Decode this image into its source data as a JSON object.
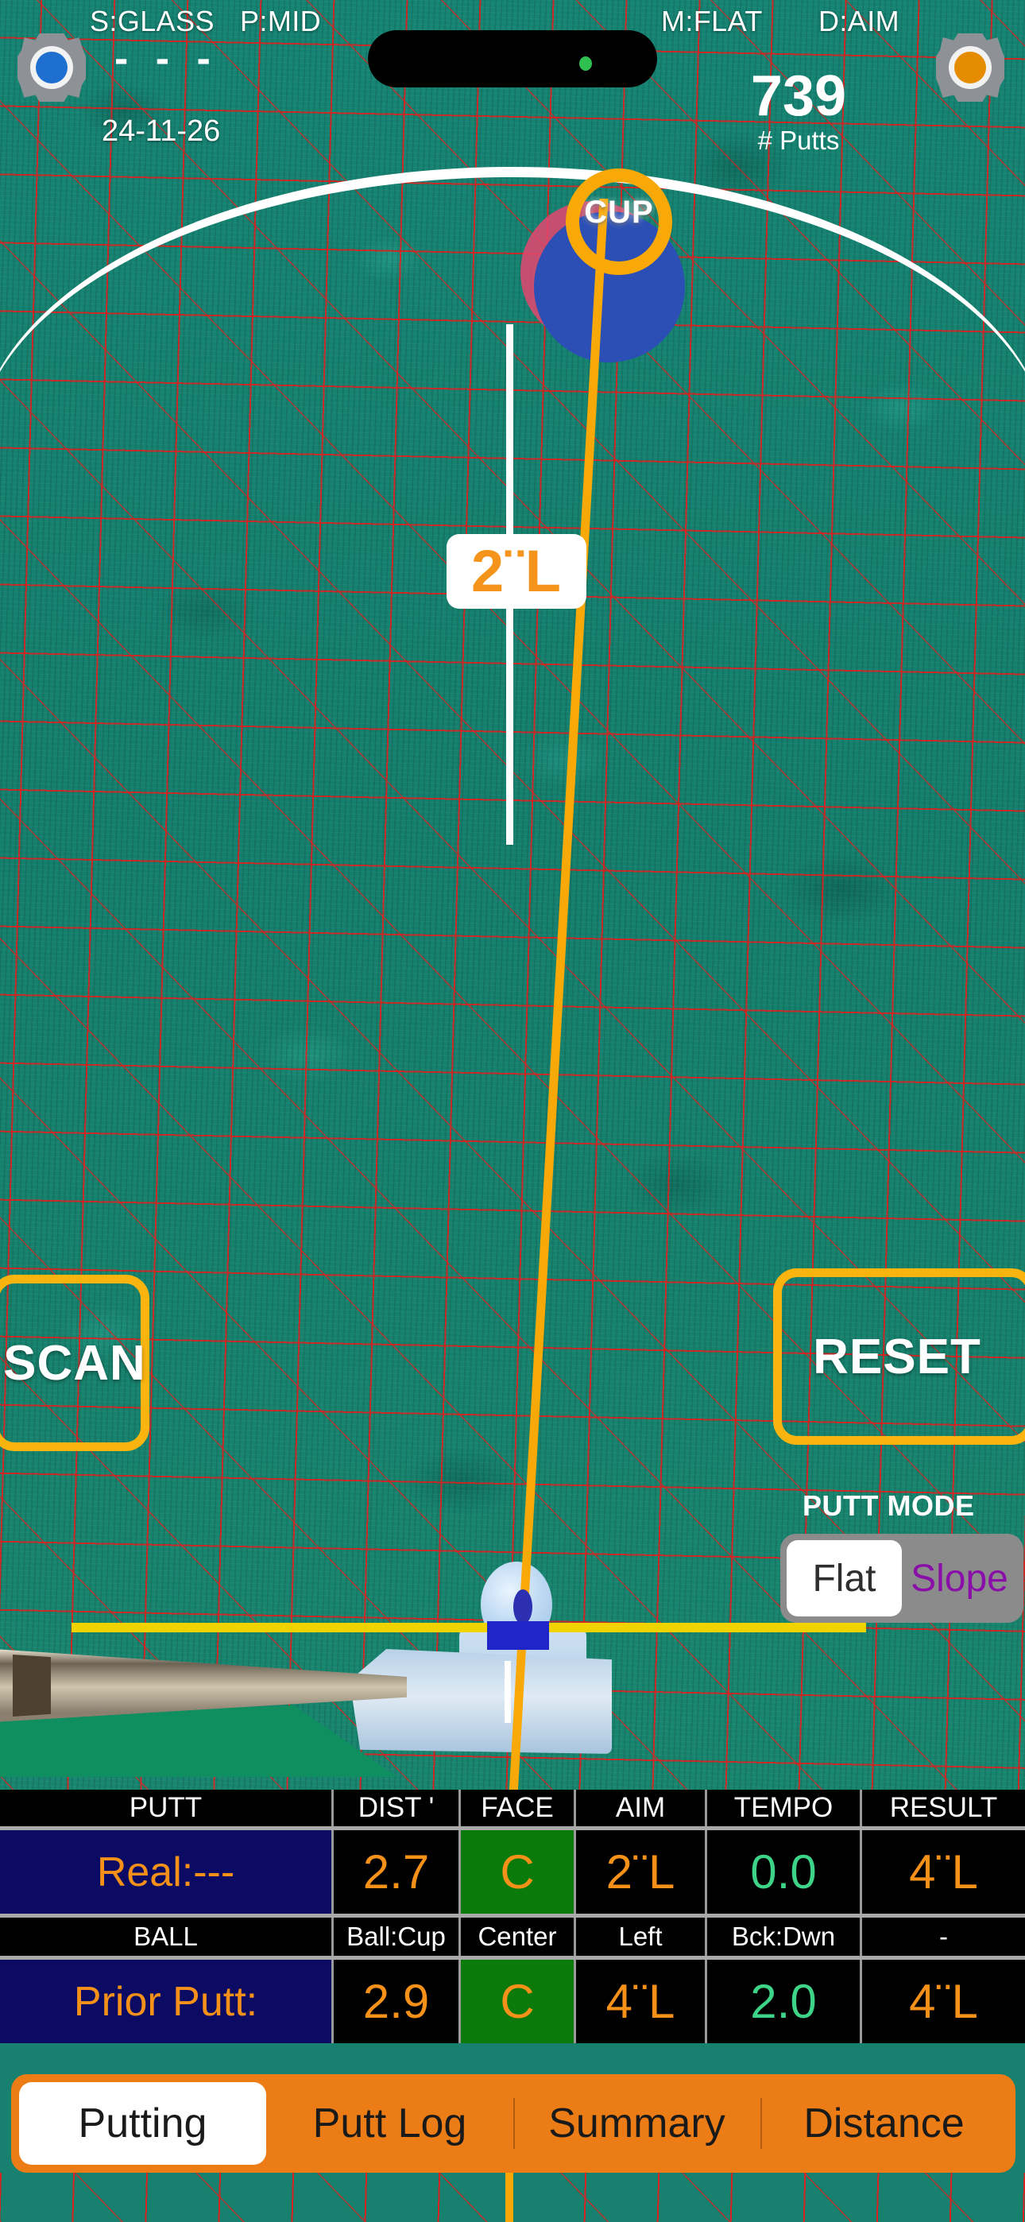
{
  "header": {
    "stimp": "S:GLASS",
    "pace": "P:MID",
    "mode": "M:FLAT",
    "display": "D:AIM",
    "dashes": "- - -",
    "date": "24-11-26",
    "putts_count": "739",
    "putts_label": "# Putts",
    "settings_left_icon": "gear-icon",
    "settings_right_icon": "gear-icon"
  },
  "green": {
    "cup_label": "CUP",
    "break_label": "2¨L",
    "accent_orange": "#f9a907",
    "turf_color": "#17806e",
    "mesh_color": "#eb1919"
  },
  "controls": {
    "scan_label": "SCAN",
    "reset_label": "RESET"
  },
  "putt_mode": {
    "title": "PUTT MODE",
    "options": [
      {
        "label": "Flat",
        "selected": true
      },
      {
        "label": "Slope",
        "selected": false
      }
    ]
  },
  "table": {
    "headers": [
      "PUTT",
      "DIST '",
      "FACE",
      "AIM",
      "TEMPO",
      "RESULT"
    ],
    "subheaders": [
      "BALL",
      "Ball:Cup",
      "Center",
      "Left",
      "Bck:Dwn",
      "-"
    ],
    "rows": [
      {
        "label": "Real:---",
        "dist": "2.7",
        "face": "C",
        "aim": "2¨L",
        "tempo": "0.0",
        "result": "4¨L"
      },
      {
        "label": "Prior Putt:",
        "dist": "2.9",
        "face": "C",
        "aim": "4¨L",
        "tempo": "2.0",
        "result": "4¨L"
      }
    ]
  },
  "tabs": [
    {
      "label": "Putting",
      "active": true
    },
    {
      "label": "Putt Log",
      "active": false
    },
    {
      "label": "Summary",
      "active": false
    },
    {
      "label": "Distance",
      "active": false
    }
  ]
}
